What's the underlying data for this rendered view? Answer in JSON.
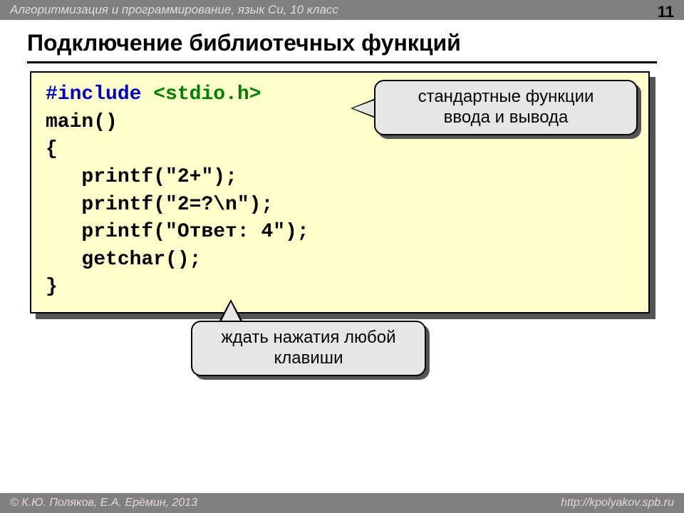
{
  "header": {
    "course": "Алгоритмизация и программирование, язык Си, 10 класс",
    "page": "11"
  },
  "title": "Подключение библиотечных функций",
  "code": {
    "include": "#include",
    "header_file": "<stdio.h>",
    "main": "main()",
    "open": "{",
    "l1a": "printf(",
    "l1b": "\"2+\"",
    "l1c": ");",
    "l2a": "printf(",
    "l2b": "\"2=?\\n\"",
    "l2c": ");",
    "l3a": "printf(",
    "l3b": "\"Ответ: 4\"",
    "l3c": ");",
    "l4": "getchar();",
    "close": "}"
  },
  "callouts": {
    "c1l1": "стандартные функции",
    "c1l2": "ввода и вывода",
    "c2l1": "ждать нажатия любой",
    "c2l2": "клавиши"
  },
  "footer": {
    "left": "© К.Ю. Поляков, Е.А. Ерёмин, 2013",
    "right": "http://kpolyakov.spb.ru"
  }
}
